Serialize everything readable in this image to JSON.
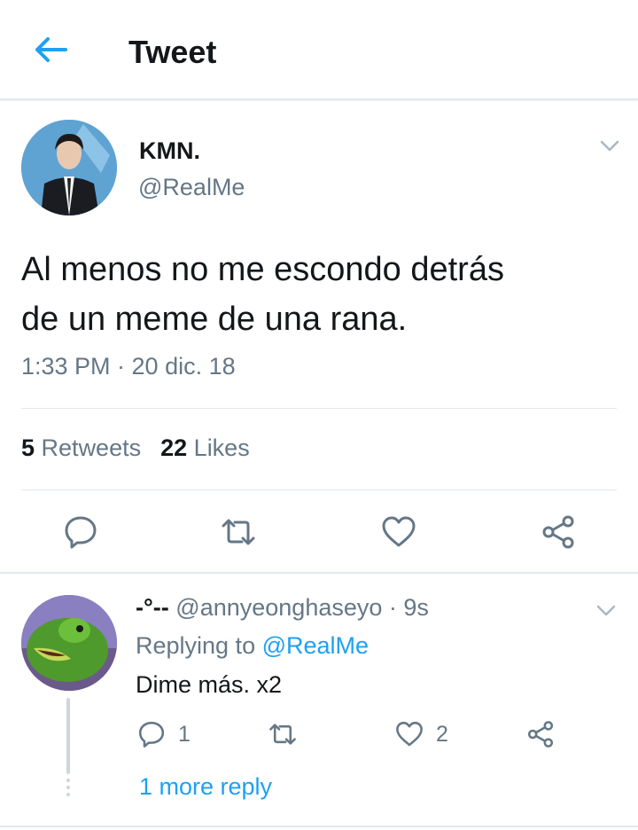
{
  "header": {
    "title": "Tweet"
  },
  "tweet": {
    "name": "KMN.",
    "handle": "@RealMe",
    "text_line1": "Al menos no me escondo detrás",
    "text_line2": "de un meme de una rana.",
    "timestamp": "1:33 PM · 20 dic. 18",
    "retweets_count": "5",
    "retweets_label": "Retweets",
    "likes_count": "22",
    "likes_label": "Likes"
  },
  "reply": {
    "name": "-°--",
    "handle": "@annyeonghaseyo",
    "time": "· 9s",
    "replying_prefix": "Replying to",
    "replying_mention": "@RealMe",
    "text": "Dime más. x2",
    "reply_count": "1",
    "like_count": "2",
    "more_replies": "1 more reply"
  },
  "colors": {
    "accent": "#1da1f2",
    "secondary_text": "#657786",
    "divider": "#e1e8ed"
  }
}
